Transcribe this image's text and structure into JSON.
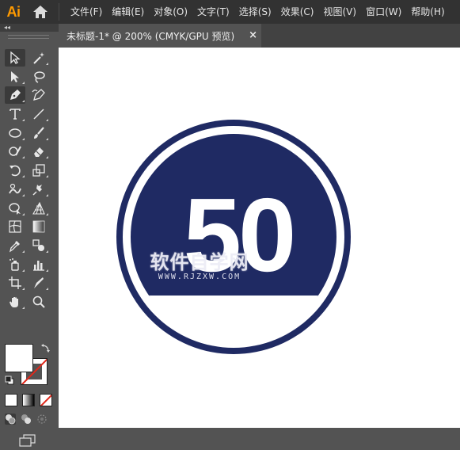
{
  "app": {
    "logo_text": "Ai",
    "brand_color": "#ff9a00"
  },
  "menu": {
    "items": [
      {
        "label": "文件(F)"
      },
      {
        "label": "编辑(E)"
      },
      {
        "label": "对象(O)"
      },
      {
        "label": "文字(T)"
      },
      {
        "label": "选择(S)"
      },
      {
        "label": "效果(C)"
      },
      {
        "label": "视图(V)"
      },
      {
        "label": "窗口(W)"
      },
      {
        "label": "帮助(H)"
      }
    ]
  },
  "toolbar": {
    "collapse_label": "◂◂",
    "tools": [
      "selection-tool-icon",
      "magic-wand-icon",
      "direct-selection-icon",
      "lasso-icon",
      "pen-icon",
      "curvature-icon",
      "type-icon",
      "line-segment-icon",
      "ellipse-icon",
      "paintbrush-icon",
      "shaper-icon",
      "eraser-icon",
      "rotate-icon",
      "scale-icon",
      "warp-icon",
      "puppet-warp-icon",
      "shape-builder-icon",
      "perspective-grid-icon",
      "mesh-icon",
      "gradient-icon",
      "eyedropper-icon",
      "blend-icon",
      "symbol-sprayer-icon",
      "column-graph-icon",
      "artboard-icon",
      "slice-icon",
      "hand-icon",
      "zoom-icon"
    ],
    "fill_color": "#ffffff",
    "stroke_color": "none"
  },
  "document": {
    "tab_title": "未标题-1* @ 200% (CMYK/GPU 预览)",
    "close_label": "×"
  },
  "artwork": {
    "sign_number": "50",
    "sign_color": "#1f2a63",
    "watermark_main": "软件自学网",
    "watermark_sub": "WWW.RJZXW.COM"
  }
}
